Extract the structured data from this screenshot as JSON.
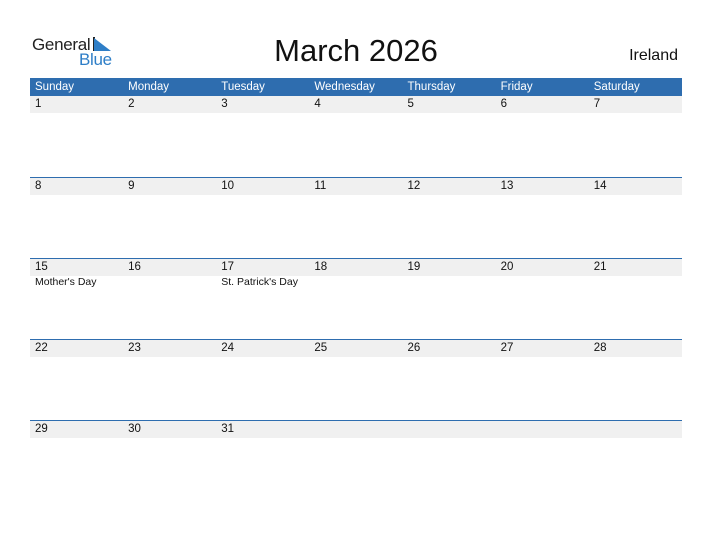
{
  "logo": {
    "general": "General",
    "blue": "Blue"
  },
  "title": "March 2026",
  "country": "Ireland",
  "colors": {
    "accent": "#2e6daf",
    "logo_blue": "#2e7ec7",
    "date_strip": "#f0f0f0"
  },
  "weekdays": [
    "Sunday",
    "Monday",
    "Tuesday",
    "Wednesday",
    "Thursday",
    "Friday",
    "Saturday"
  ],
  "weeks": [
    {
      "days": [
        {
          "num": "1",
          "event": ""
        },
        {
          "num": "2",
          "event": ""
        },
        {
          "num": "3",
          "event": ""
        },
        {
          "num": "4",
          "event": ""
        },
        {
          "num": "5",
          "event": ""
        },
        {
          "num": "6",
          "event": ""
        },
        {
          "num": "7",
          "event": ""
        }
      ]
    },
    {
      "days": [
        {
          "num": "8",
          "event": ""
        },
        {
          "num": "9",
          "event": ""
        },
        {
          "num": "10",
          "event": ""
        },
        {
          "num": "11",
          "event": ""
        },
        {
          "num": "12",
          "event": ""
        },
        {
          "num": "13",
          "event": ""
        },
        {
          "num": "14",
          "event": ""
        }
      ]
    },
    {
      "days": [
        {
          "num": "15",
          "event": "Mother's Day"
        },
        {
          "num": "16",
          "event": ""
        },
        {
          "num": "17",
          "event": "St. Patrick's Day"
        },
        {
          "num": "18",
          "event": ""
        },
        {
          "num": "19",
          "event": ""
        },
        {
          "num": "20",
          "event": ""
        },
        {
          "num": "21",
          "event": ""
        }
      ]
    },
    {
      "days": [
        {
          "num": "22",
          "event": ""
        },
        {
          "num": "23",
          "event": ""
        },
        {
          "num": "24",
          "event": ""
        },
        {
          "num": "25",
          "event": ""
        },
        {
          "num": "26",
          "event": ""
        },
        {
          "num": "27",
          "event": ""
        },
        {
          "num": "28",
          "event": ""
        }
      ]
    },
    {
      "days": [
        {
          "num": "29",
          "event": ""
        },
        {
          "num": "30",
          "event": ""
        },
        {
          "num": "31",
          "event": ""
        },
        {
          "num": "",
          "event": ""
        },
        {
          "num": "",
          "event": ""
        },
        {
          "num": "",
          "event": ""
        },
        {
          "num": "",
          "event": ""
        }
      ]
    }
  ]
}
